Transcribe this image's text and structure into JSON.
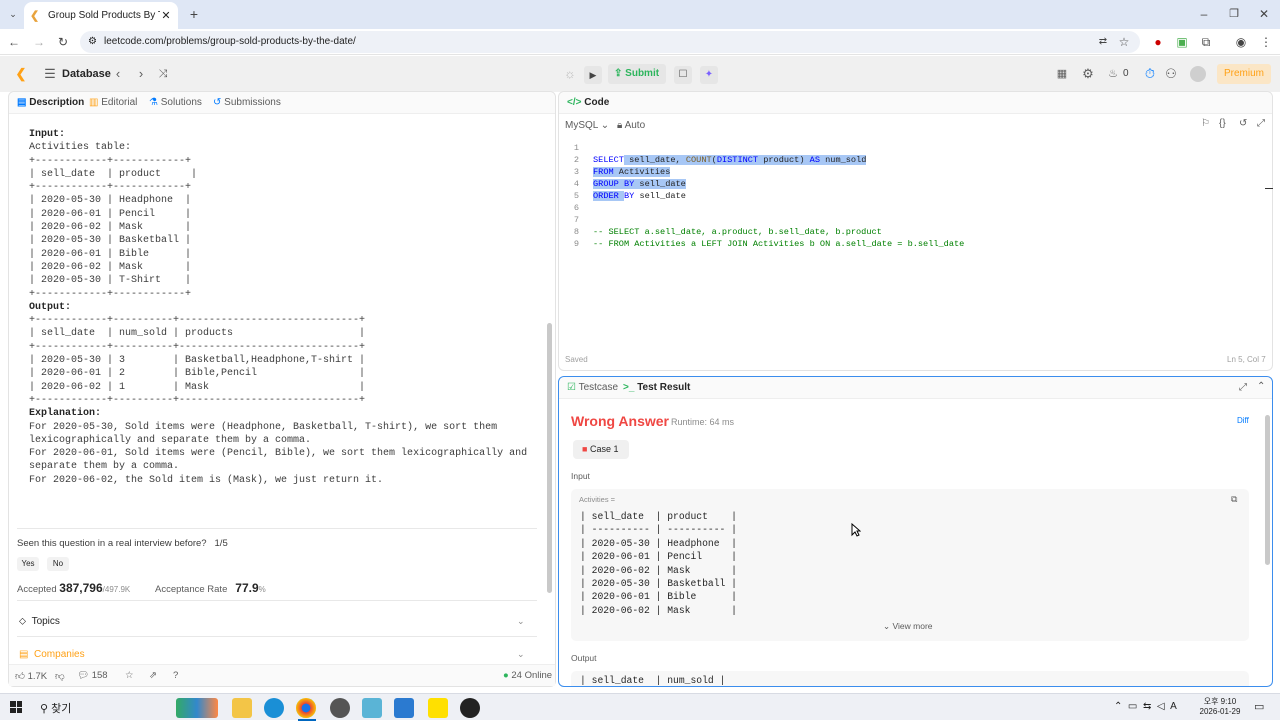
{
  "browser": {
    "tab_title": "Group Sold Products By The D",
    "url": "leetcode.com/problems/group-sold-products-by-the-date/"
  },
  "header": {
    "section": "Database",
    "submit": "Submit",
    "fire_count": "0",
    "premium": "Premium"
  },
  "left": {
    "tabs": [
      "Description",
      "Editorial",
      "Solutions",
      "Submissions"
    ],
    "example_lines": [
      {
        "t": "Input:",
        "b": true
      },
      {
        "t": "Activities table:"
      },
      {
        "t": "+------------+------------+"
      },
      {
        "t": "| sell_date  | product     |"
      },
      {
        "t": "+------------+------------+"
      },
      {
        "t": "| 2020-05-30 | Headphone  |"
      },
      {
        "t": "| 2020-06-01 | Pencil     |"
      },
      {
        "t": "| 2020-06-02 | Mask       |"
      },
      {
        "t": "| 2020-05-30 | Basketball |"
      },
      {
        "t": "| 2020-06-01 | Bible      |"
      },
      {
        "t": "| 2020-06-02 | Mask       |"
      },
      {
        "t": "| 2020-05-30 | T-Shirt    |"
      },
      {
        "t": "+------------+------------+"
      },
      {
        "t": "Output:",
        "b": true
      },
      {
        "t": "+------------+----------+------------------------------+"
      },
      {
        "t": "| sell_date  | num_sold | products                     |"
      },
      {
        "t": "+------------+----------+------------------------------+"
      },
      {
        "t": "| 2020-05-30 | 3        | Basketball,Headphone,T-shirt |"
      },
      {
        "t": "| 2020-06-01 | 2        | Bible,Pencil                 |"
      },
      {
        "t": "| 2020-06-02 | 1        | Mask                         |"
      },
      {
        "t": "+------------+----------+------------------------------+"
      },
      {
        "t": "Explanation:",
        "b": true
      },
      {
        "t": "For 2020-05-30, Sold items were (Headphone, Basketball, T-shirt), we sort them"
      },
      {
        "t": "lexicographically and separate them by a comma."
      },
      {
        "t": "For 2020-06-01, Sold items were (Pencil, Bible), we sort them lexicographically and"
      },
      {
        "t": "separate them by a comma."
      },
      {
        "t": "For 2020-06-02, the Sold item is (Mask), we just return it."
      }
    ],
    "interview_q": "Seen this question in a real interview before?",
    "interview_ratio": "1/5",
    "yes": "Yes",
    "no": "No",
    "accepted_label": "Accepted",
    "accepted_value": "387,796",
    "accepted_total": "/497.9K",
    "acceptance_label": "Acceptance Rate",
    "acceptance_value": "77.9",
    "acceptance_unit": "%",
    "topics": "Topics",
    "companies": "Companies",
    "likes": "1.7K",
    "comments": "158",
    "online": "24 Online"
  },
  "code": {
    "title": "Code",
    "lang": "MySQL",
    "auto": "Auto",
    "saved": "Saved",
    "cursor": "Ln 5, Col 7"
  },
  "result": {
    "tab_testcase": "Testcase",
    "tab_result": "Test Result",
    "verdict": "Wrong Answer",
    "runtime": "Runtime: 64 ms",
    "diff": "Diff",
    "case": "Case 1",
    "input_label": "Input",
    "table_name": "Activities =",
    "input_lines": [
      "| sell_date  | product    |",
      "| ---------- | ---------- |",
      "| 2020-05-30 | Headphone  |",
      "| 2020-06-01 | Pencil     |",
      "| 2020-06-02 | Mask       |",
      "| 2020-05-30 | Basketball |",
      "| 2020-06-01 | Bible      |",
      "| 2020-06-02 | Mask       |"
    ],
    "view_more": "View more",
    "output_label": "Output",
    "output_first": "| sell_date  | num_sold |"
  },
  "taskbar": {
    "search": "찾기",
    "time": "오후 9:10",
    "date": "2026-01-29"
  },
  "colors": {
    "verdict": "#ef4743",
    "submit": "#2db55d",
    "premium": "#ffa116",
    "accent": "#007aff"
  }
}
